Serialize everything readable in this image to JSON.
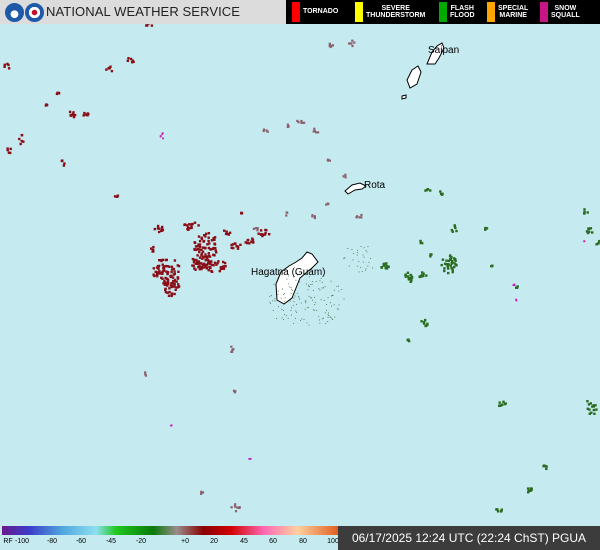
{
  "header": {
    "title": "NATIONAL WEATHER SERVICE",
    "logos": [
      "noaa-logo",
      "nws-logo"
    ]
  },
  "warning_legend": [
    {
      "label": "TORNADO",
      "color": "#ff0000"
    },
    {
      "label": "SEVERE\nTHUNDERSTORM",
      "color": "#ffff00"
    },
    {
      "label": "FLASH\nFLOOD",
      "color": "#00aa00"
    },
    {
      "label": "SPECIAL\nMARINE",
      "color": "#ffa500"
    },
    {
      "label": "SNOW\nSQUALL",
      "color": "#c71585"
    }
  ],
  "places": [
    {
      "name": "Saipan"
    },
    {
      "name": "Rota"
    },
    {
      "name": "Hagatna (Guam)"
    }
  ],
  "reflectivity_scale": {
    "prefix": "RF",
    "ticks": [
      "-100",
      "-80",
      "-60",
      "-45",
      "-20",
      "+0",
      "20",
      "45",
      "60",
      "80",
      "100"
    ]
  },
  "timestamp": "06/17/2025 12:24 UTC (22:24 ChST) PGUA",
  "colors": {
    "ocean": "#c5ebf1",
    "land": "#ffffff",
    "echo_dark_red": "#8b0e17",
    "echo_green": "#2a6b1e",
    "echo_mauve": "#8a5f6a",
    "echo_magenta": "#c81eb4"
  }
}
